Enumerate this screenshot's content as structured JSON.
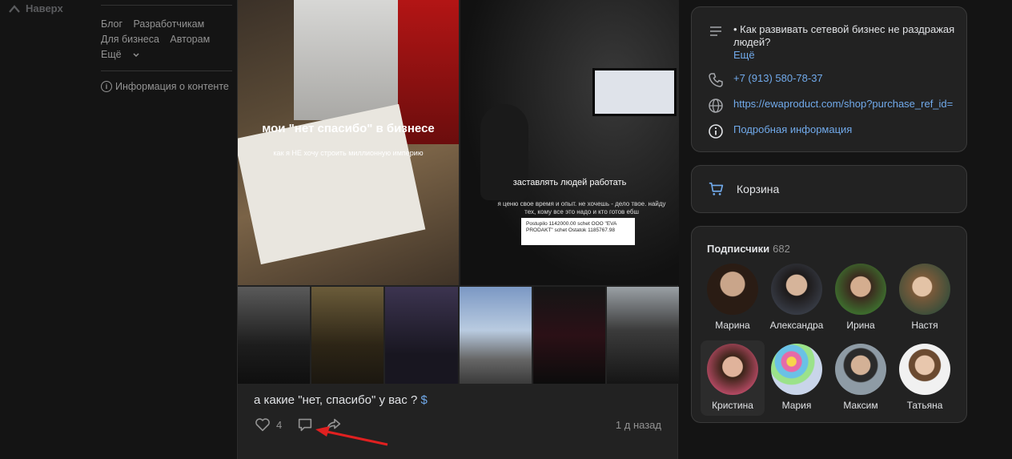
{
  "nav": {
    "up_label": "Наверх"
  },
  "footer_links": {
    "row1": [
      "Блог",
      "Разработчикам"
    ],
    "row2": [
      "Для бизнеса",
      "Авторам"
    ],
    "more": "Ещё",
    "info": "Информация о контенте"
  },
  "post": {
    "image_main_title": "мои \"нет спасибо\" в бизнесе",
    "image_main_sub": "как я НЕ хочу строить миллионную империю",
    "image_side_title": "заставлять людей работать",
    "image_side_text": "я ценю свое время и опыт. не хочешь - дело твое. найду тех, кому все это надо и кто готов ебш",
    "image_side_card": "Postupilo 1142000.00 schet OOO \"EVA PRODAKT\" schet Ostatok 1185767.98",
    "caption": "а какие \"нет, спасибо\" у вас ?",
    "caption_symbol": "$",
    "likes": "4",
    "time": "1 д назад"
  },
  "community_info": {
    "description": "• Как развивать сетевой бизнес не раздражая людей?",
    "more": "Ещё",
    "phone": "+7 (913) 580-78-37",
    "url": "https://ewaproduct.com/shop?purchase_ref_id=",
    "details": "Подробная информация"
  },
  "cart": {
    "label": "Корзина"
  },
  "subscribers": {
    "title": "Подписчики",
    "count": "682",
    "items": [
      {
        "name": "Марина"
      },
      {
        "name": "Александра"
      },
      {
        "name": "Ирина"
      },
      {
        "name": "Настя"
      },
      {
        "name": "Кристина"
      },
      {
        "name": "Мария"
      },
      {
        "name": "Максим"
      },
      {
        "name": "Татьяна"
      }
    ]
  },
  "colors": {
    "accent": "#71aaeb",
    "background": "#141414",
    "card": "#222222",
    "arrow": "#e02020"
  }
}
